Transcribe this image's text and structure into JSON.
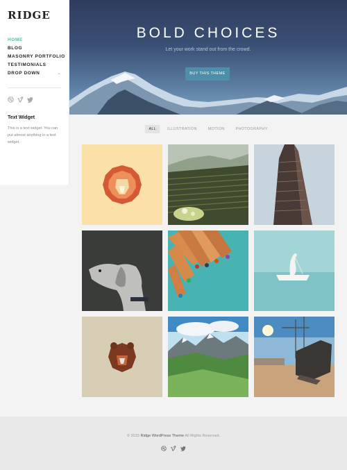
{
  "site": {
    "logo": "RIDGE"
  },
  "sidebar": {
    "nav": [
      {
        "label": "HOME",
        "active": true
      },
      {
        "label": "BLOG"
      },
      {
        "label": "MASONRY PORTFOLIO"
      },
      {
        "label": "TESTIMONIALS"
      },
      {
        "label": "DROP DOWN",
        "chevron": "⌄"
      }
    ],
    "social_icons": [
      "dribbble-icon",
      "vimeo-icon",
      "twitter-icon"
    ],
    "widget": {
      "title": "Text Widget",
      "text": "This is a text widget. You can put almost anything in a text widget."
    }
  },
  "hero": {
    "title": "BOLD CHOICES",
    "subtitle": "Let your work stand out from the crowd.",
    "button_label": "BUY THIS THEME"
  },
  "filters": [
    "ALL",
    "ILLUSTRATION",
    "MOTION",
    "PHOTOGRAPHY"
  ],
  "portfolio": {
    "items": [
      "lion-illustration",
      "terraced-hills-photo",
      "flatiron-building-photo",
      "dog-photo",
      "colored-pencils-photo",
      "bird-on-boat-photo",
      "bear-illustration",
      "alpine-valley-photo",
      "excavator-photo"
    ]
  },
  "footer": {
    "copyright_prefix": "© 2015",
    "copyright_link": "Ridge WordPress Theme",
    "copyright_suffix": "All Rights Reserved."
  },
  "colors": {
    "accent": "#5cb8a4",
    "button": "#4d8fa8",
    "hero_top": "#2f3c5e"
  }
}
